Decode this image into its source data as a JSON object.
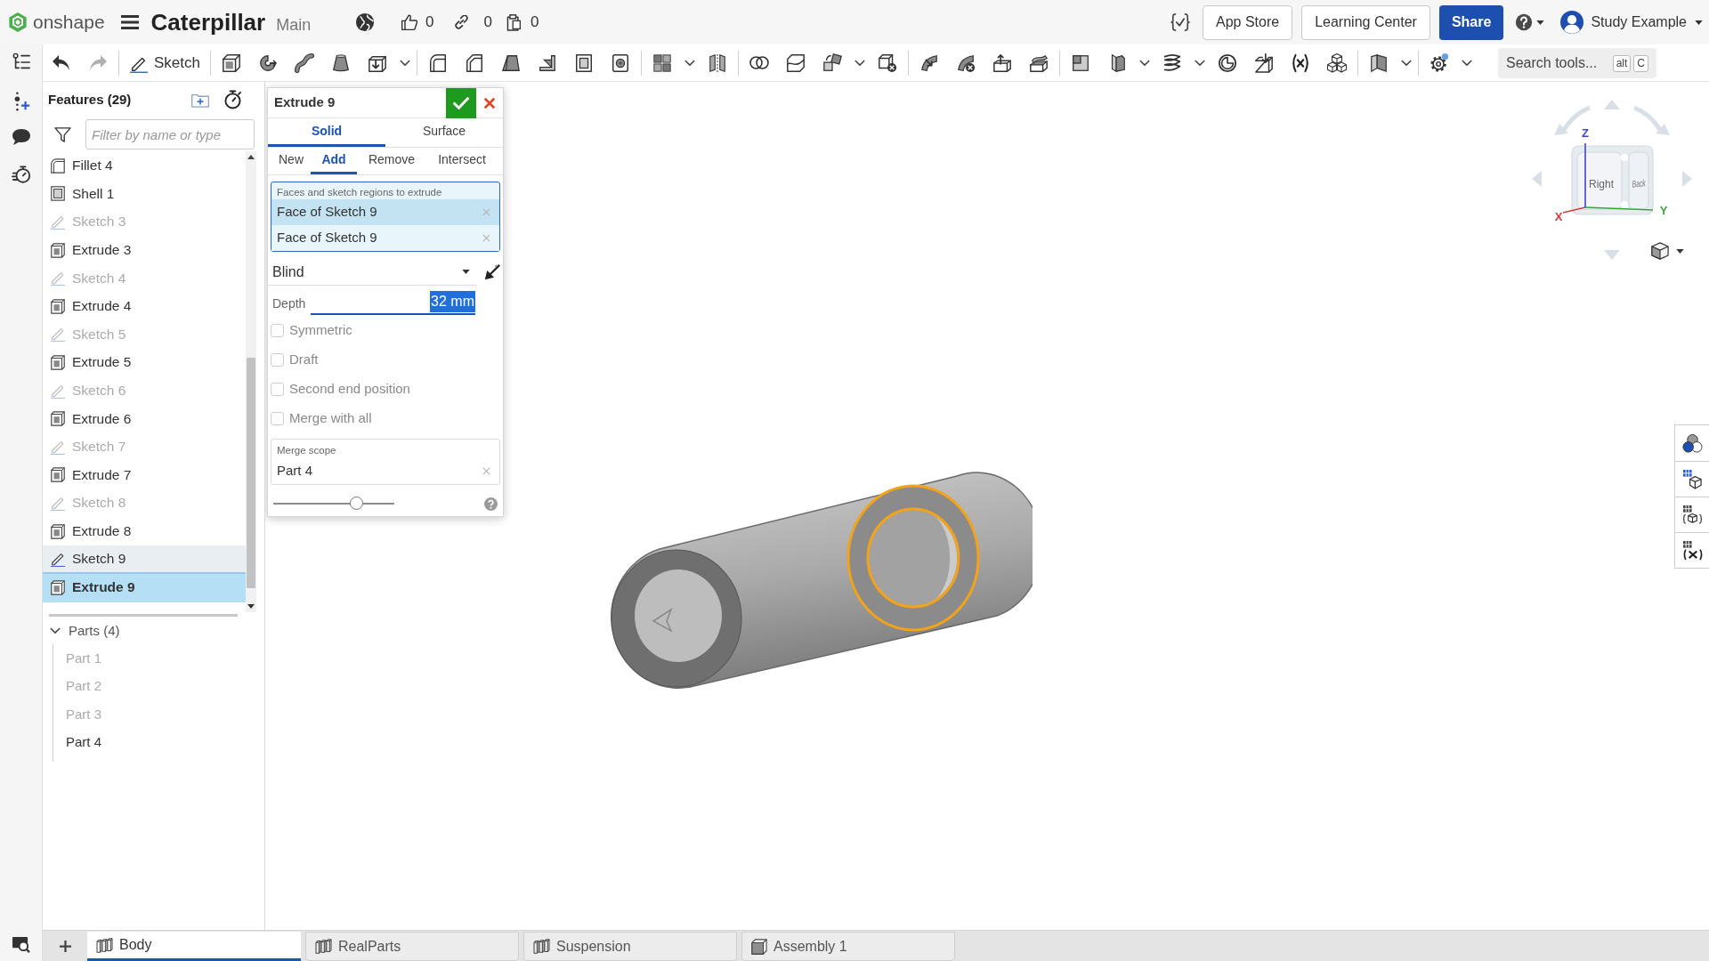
{
  "header": {
    "logo_text": "onshape",
    "document_title": "Caterpillar",
    "workspace": "Main",
    "counters": [
      {
        "kind": "likes",
        "value": "0"
      },
      {
        "kind": "links",
        "value": "0"
      },
      {
        "kind": "copies",
        "value": "0"
      }
    ],
    "buttons": [
      {
        "label": "App Store",
        "kind": "outline"
      },
      {
        "label": "Learning Center",
        "kind": "outline"
      },
      {
        "label": "Share",
        "kind": "primary"
      }
    ],
    "user": {
      "name": "Study Example"
    }
  },
  "toolbar": {
    "history": [
      {
        "kind": "undo",
        "disabled": false
      },
      {
        "kind": "redo",
        "disabled": true
      }
    ],
    "sketch_label": "Sketch",
    "search": {
      "placeholder": "Search tools...",
      "shortcut": [
        "alt",
        "C"
      ]
    }
  },
  "features_panel": {
    "title": "Features (29)",
    "filter": {
      "placeholder": "Filter by name or type"
    },
    "features": [
      {
        "name": "Fillet 4",
        "kind": "fillet",
        "hidden": false,
        "selected": false,
        "highlighted": false
      },
      {
        "name": "Shell 1",
        "kind": "shell",
        "hidden": false,
        "selected": false,
        "highlighted": false
      },
      {
        "name": "Sketch 3",
        "kind": "sketch",
        "hidden": true,
        "selected": false,
        "highlighted": false
      },
      {
        "name": "Extrude 3",
        "kind": "extrude",
        "hidden": false,
        "selected": false,
        "highlighted": false
      },
      {
        "name": "Sketch 4",
        "kind": "sketch",
        "hidden": true,
        "selected": false,
        "highlighted": false
      },
      {
        "name": "Extrude 4",
        "kind": "extrude",
        "hidden": false,
        "selected": false,
        "highlighted": false
      },
      {
        "name": "Sketch 5",
        "kind": "sketch",
        "hidden": true,
        "selected": false,
        "highlighted": false
      },
      {
        "name": "Extrude 5",
        "kind": "extrude",
        "hidden": false,
        "selected": false,
        "highlighted": false
      },
      {
        "name": "Sketch 6",
        "kind": "sketch",
        "hidden": true,
        "selected": false,
        "highlighted": false
      },
      {
        "name": "Extrude 6",
        "kind": "extrude",
        "hidden": false,
        "selected": false,
        "highlighted": false
      },
      {
        "name": "Sketch 7",
        "kind": "sketch",
        "hidden": true,
        "selected": false,
        "highlighted": false
      },
      {
        "name": "Extrude 7",
        "kind": "extrude",
        "hidden": false,
        "selected": false,
        "highlighted": false
      },
      {
        "name": "Sketch 8",
        "kind": "sketch",
        "hidden": true,
        "selected": false,
        "highlighted": false
      },
      {
        "name": "Extrude 8",
        "kind": "extrude",
        "hidden": false,
        "selected": false,
        "highlighted": false
      },
      {
        "name": "Sketch 9",
        "kind": "sketch",
        "hidden": false,
        "selected": false,
        "highlighted": true
      },
      {
        "name": "Extrude 9",
        "kind": "extrude",
        "hidden": false,
        "selected": true,
        "highlighted": false
      }
    ],
    "parts_group": {
      "label": "Parts (4)",
      "expanded": true,
      "parts": [
        {
          "name": "Part 1",
          "hidden": true
        },
        {
          "name": "Part 2",
          "hidden": true
        },
        {
          "name": "Part 3",
          "hidden": true
        },
        {
          "name": "Part 4",
          "hidden": false
        }
      ]
    }
  },
  "feature_dialog": {
    "title": "Extrude 9",
    "body_types": [
      {
        "label": "Solid",
        "selected": true
      },
      {
        "label": "Surface",
        "selected": false
      }
    ],
    "operations": [
      {
        "label": "New",
        "selected": false
      },
      {
        "label": "Add",
        "selected": true
      },
      {
        "label": "Remove",
        "selected": false
      },
      {
        "label": "Intersect",
        "selected": false
      }
    ],
    "selection_field": {
      "label": "Faces and sketch regions to extrude",
      "items": [
        {
          "text": "Face of Sketch 9",
          "highlighted": true
        },
        {
          "text": "Face of Sketch 9",
          "highlighted": false
        }
      ]
    },
    "end_type": {
      "value": "Blind"
    },
    "depth": {
      "label": "Depth",
      "value": "32 mm",
      "text_selected": true
    },
    "options": [
      {
        "label": "Symmetric",
        "checked": false
      },
      {
        "label": "Draft",
        "checked": false
      },
      {
        "label": "Second end position",
        "checked": false
      },
      {
        "label": "Merge with all",
        "checked": false
      }
    ],
    "merge_scope": {
      "label": "Merge scope",
      "items": [
        {
          "text": "Part 4"
        }
      ]
    },
    "detail_slider": {
      "level": 0.69
    }
  },
  "view_cube": {
    "faces": [
      "Right",
      "Back"
    ],
    "axes": [
      {
        "label": "X",
        "color": "#d93b3b"
      },
      {
        "label": "Y",
        "color": "#38a838"
      },
      {
        "label": "Z",
        "color": "#4040d8"
      }
    ]
  },
  "tabs": [
    {
      "label": "Body",
      "kind": "part_studio",
      "selected": true
    },
    {
      "label": "RealParts",
      "kind": "part_studio",
      "selected": false
    },
    {
      "label": "Suspension",
      "kind": "part_studio",
      "selected": false
    },
    {
      "label": "Assembly 1",
      "kind": "assembly",
      "selected": false
    }
  ]
}
